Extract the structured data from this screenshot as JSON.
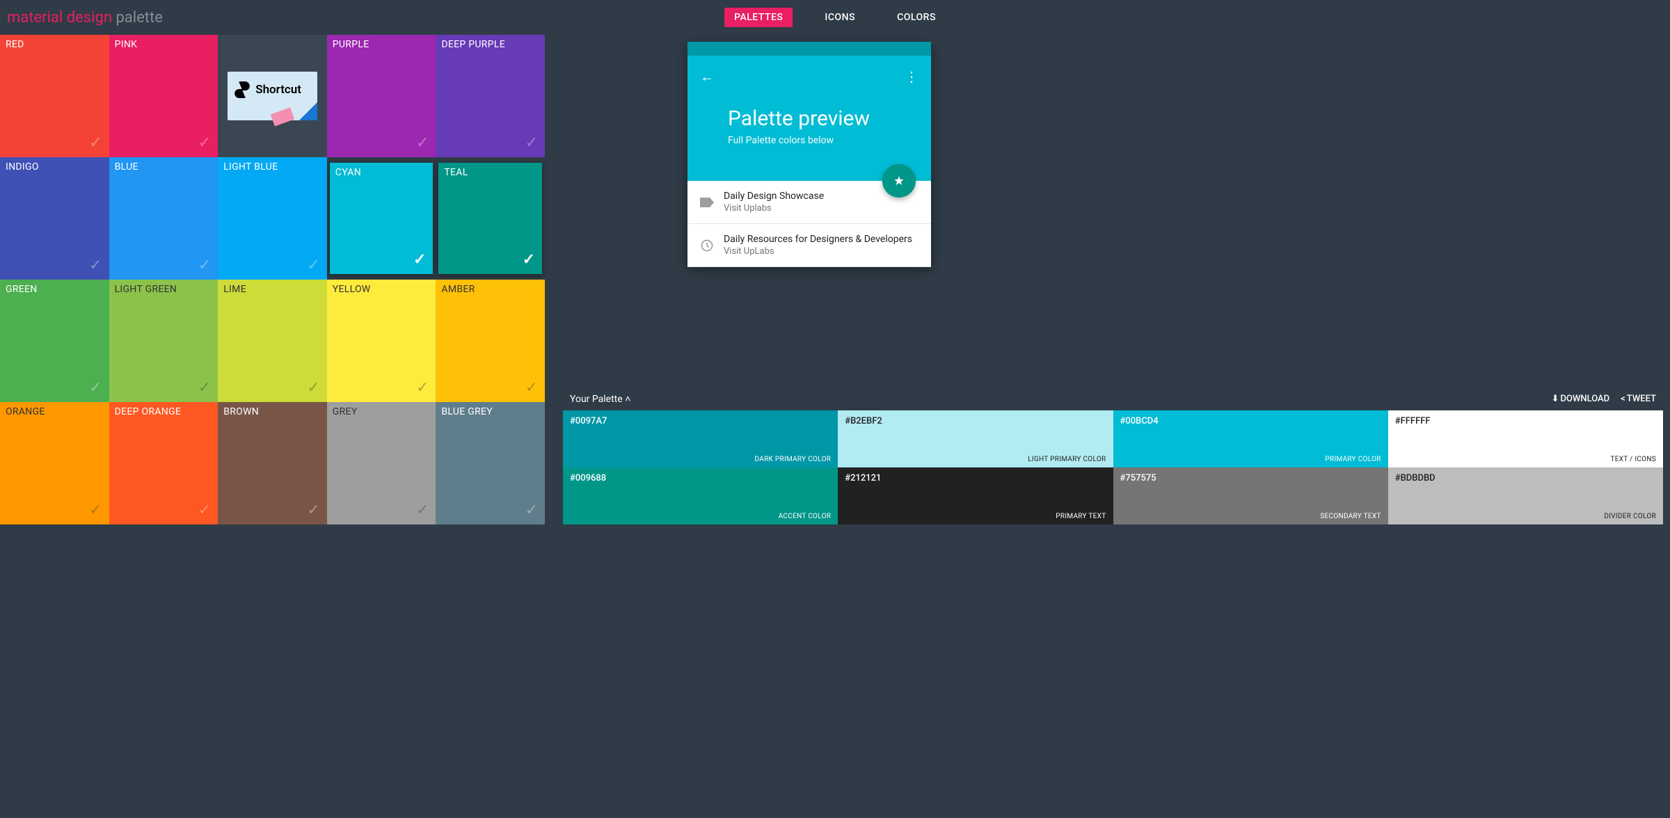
{
  "logo": {
    "part1": "material design",
    "part2": "palette"
  },
  "nav": [
    {
      "label": "PALETTES",
      "active": true
    },
    {
      "label": "ICONS",
      "active": false
    },
    {
      "label": "COLORS",
      "active": false
    }
  ],
  "ad": {
    "text": "Shortcut"
  },
  "colors": [
    {
      "name": "RED",
      "hex": "#f44336",
      "selected": false,
      "dark": false
    },
    {
      "name": "PINK",
      "hex": "#e91e63",
      "selected": false,
      "dark": false
    },
    {
      "name": "AD",
      "hex": "",
      "selected": false,
      "dark": false
    },
    {
      "name": "PURPLE",
      "hex": "#9c27b0",
      "selected": false,
      "dark": false
    },
    {
      "name": "DEEP PURPLE",
      "hex": "#673ab7",
      "selected": false,
      "dark": false
    },
    {
      "name": "INDIGO",
      "hex": "#3f51b5",
      "selected": false,
      "dark": false
    },
    {
      "name": "BLUE",
      "hex": "#2196f3",
      "selected": false,
      "dark": false
    },
    {
      "name": "LIGHT BLUE",
      "hex": "#03a9f4",
      "selected": false,
      "dark": false
    },
    {
      "name": "CYAN",
      "hex": "#00bcd4",
      "selected": true,
      "dark": false
    },
    {
      "name": "TEAL",
      "hex": "#009688",
      "selected": true,
      "dark": false
    },
    {
      "name": "GREEN",
      "hex": "#4caf50",
      "selected": false,
      "dark": false
    },
    {
      "name": "LIGHT GREEN",
      "hex": "#8bc34a",
      "selected": false,
      "dark": true
    },
    {
      "name": "LIME",
      "hex": "#cddc39",
      "selected": false,
      "dark": true
    },
    {
      "name": "YELLOW",
      "hex": "#ffeb3b",
      "selected": false,
      "dark": true
    },
    {
      "name": "AMBER",
      "hex": "#ffc107",
      "selected": false,
      "dark": true
    },
    {
      "name": "ORANGE",
      "hex": "#ff9800",
      "selected": false,
      "dark": true
    },
    {
      "name": "DEEP ORANGE",
      "hex": "#ff5722",
      "selected": false,
      "dark": false
    },
    {
      "name": "BROWN",
      "hex": "#795548",
      "selected": false,
      "dark": false
    },
    {
      "name": "GREY",
      "hex": "#9e9e9e",
      "selected": false,
      "dark": true
    },
    {
      "name": "BLUE GREY",
      "hex": "#607d8b",
      "selected": false,
      "dark": false
    }
  ],
  "preview": {
    "title": "Palette preview",
    "subtitle": "Full Palette colors below",
    "rows": [
      {
        "title": "Daily Design Showcase",
        "sub": "Visit Uplabs",
        "icon": "label"
      },
      {
        "title": "Daily Resources for Designers & Developers",
        "sub": "Visit UpLabs",
        "icon": "clock"
      }
    ]
  },
  "palette_bar": {
    "title": "Your Palette",
    "download": "DOWNLOAD",
    "tweet": "TWEET",
    "swatches": [
      {
        "hex": "#0097A7",
        "role": "DARK PRIMARY COLOR",
        "bg": "#0097a7",
        "dark": false
      },
      {
        "hex": "#B2EBF2",
        "role": "LIGHT PRIMARY COLOR",
        "bg": "#b2ebf2",
        "dark": true
      },
      {
        "hex": "#00BCD4",
        "role": "PRIMARY COLOR",
        "bg": "#00bcd4",
        "dark": false
      },
      {
        "hex": "#FFFFFF",
        "role": "TEXT / ICONS",
        "bg": "#ffffff",
        "dark": true
      },
      {
        "hex": "#009688",
        "role": "ACCENT COLOR",
        "bg": "#009688",
        "dark": false
      },
      {
        "hex": "#212121",
        "role": "PRIMARY TEXT",
        "bg": "#212121",
        "dark": false
      },
      {
        "hex": "#757575",
        "role": "SECONDARY TEXT",
        "bg": "#757575",
        "dark": false
      },
      {
        "hex": "#BDBDBD",
        "role": "DIVIDER COLOR",
        "bg": "#bdbdbd",
        "dark": true
      }
    ]
  }
}
